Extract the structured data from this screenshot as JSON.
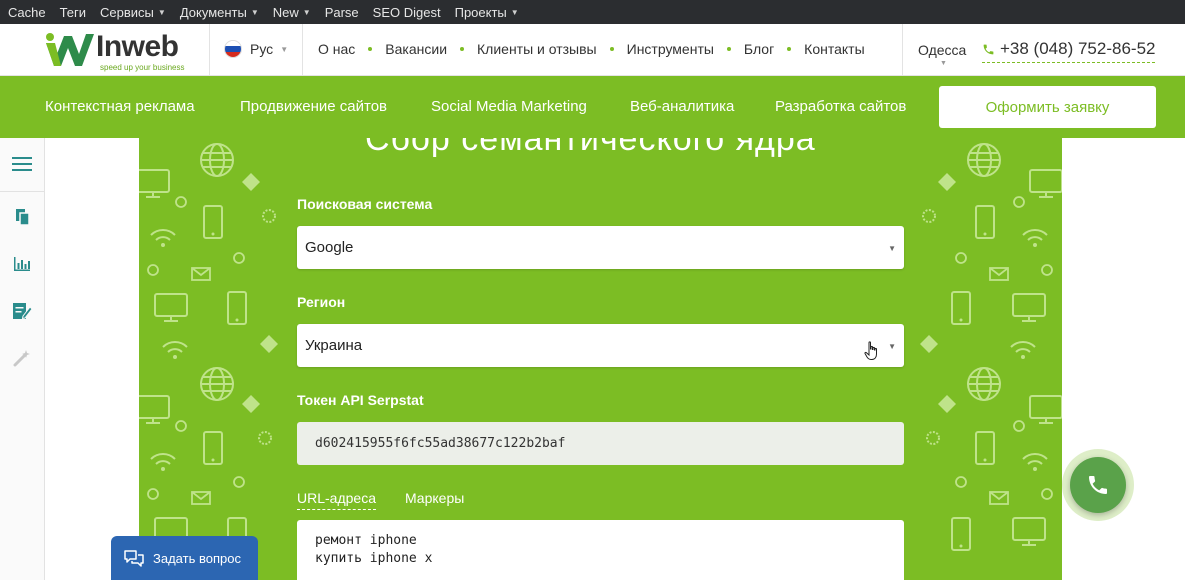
{
  "adminbar": {
    "items": [
      {
        "label": "Cache",
        "dropdown": false
      },
      {
        "label": "Теги",
        "dropdown": false
      },
      {
        "label": "Сервисы",
        "dropdown": true
      },
      {
        "label": "Документы",
        "dropdown": true
      },
      {
        "label": "New",
        "dropdown": true
      },
      {
        "label": "Parse",
        "dropdown": false
      },
      {
        "label": "SEO Digest",
        "dropdown": false
      },
      {
        "label": "Проекты",
        "dropdown": true
      }
    ]
  },
  "header": {
    "logo_text": "Inweb",
    "logo_tagline": "speed up your business",
    "language": "Рус",
    "nav": [
      "О нас",
      "Вакансии",
      "Клиенты и отзывы",
      "Инструменты",
      "Блог",
      "Контакты"
    ],
    "city": "Одесса",
    "phone": "+38 (048) 752-86-52"
  },
  "service_nav": {
    "items": [
      "Контекстная реклама",
      "Продвижение сайтов",
      "Social Media Marketing",
      "Веб-аналитика",
      "Разработка сайтов"
    ],
    "cta_label": "Оформить заявку"
  },
  "form": {
    "heading": "Сбор семантического ядра",
    "search_engine_label": "Поисковая система",
    "search_engine_value": "Google",
    "region_label": "Регион",
    "region_value": "Украина",
    "token_label": "Токен API Serpstat",
    "token_value": "d602415955f6fc55ad38677c122b2baf",
    "tabs": [
      {
        "label": "URL-адреса",
        "active": true
      },
      {
        "label": "Маркеры",
        "active": false
      }
    ],
    "keywords_text": "ремонт iphone\nкупить iphone x"
  },
  "widgets": {
    "ask_question_label": "Задать вопрос"
  },
  "colors": {
    "brand_green": "#7cbd24",
    "admin_bar": "#2b2d30",
    "ask_button": "#2c66b2",
    "call_button": "#5aa24a"
  }
}
